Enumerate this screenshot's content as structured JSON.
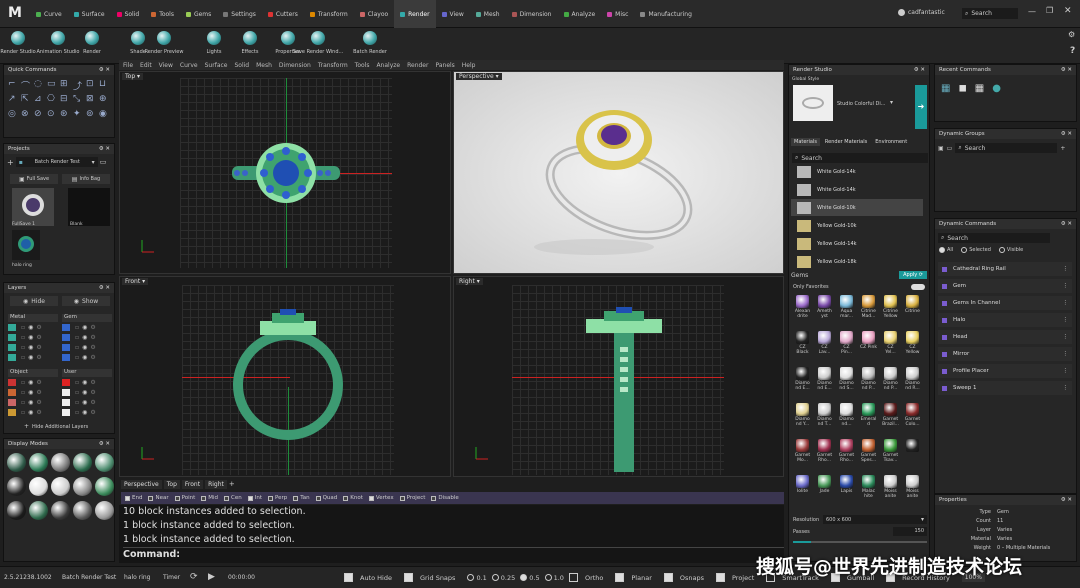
{
  "app": {
    "logo": "M"
  },
  "tabs": [
    {
      "label": "Curve",
      "color": "#4caf50"
    },
    {
      "label": "Surface",
      "color": "#3aa"
    },
    {
      "label": "Solid",
      "color": "#e06"
    },
    {
      "label": "Tools",
      "color": "#c63"
    },
    {
      "label": "Gems",
      "color": "#9c5"
    },
    {
      "label": "Settings",
      "color": "#777"
    },
    {
      "label": "Cutters",
      "color": "#d33"
    },
    {
      "label": "Transform",
      "color": "#d80"
    },
    {
      "label": "Clayoo",
      "color": "#c66"
    },
    {
      "label": "Render",
      "color": "#3aa"
    },
    {
      "label": "View",
      "color": "#66c"
    },
    {
      "label": "Mesh",
      "color": "#5a9"
    },
    {
      "label": "Dimension",
      "color": "#a55"
    },
    {
      "label": "Analyze",
      "color": "#4a4"
    },
    {
      "label": "Misc",
      "color": "#c4a"
    },
    {
      "label": "Manufacturing",
      "color": "#888"
    }
  ],
  "user": "cadfantastic",
  "search_placeholder": "Search",
  "ribbon": [
    "Render Studio",
    "Animation Studio",
    "Render",
    "Shade",
    "Render Preview",
    "Lights",
    "Effects",
    "Properties",
    "Save Render Wind...",
    "Batch Render"
  ],
  "menu": [
    "File",
    "Edit",
    "View",
    "Curve",
    "Surface",
    "Solid",
    "Mesh",
    "Dimension",
    "Transform",
    "Tools",
    "Analyze",
    "Render",
    "Panels",
    "Help"
  ],
  "quick_commands": {
    "title": "Quick Commands"
  },
  "projects": {
    "title": "Projects",
    "selected": "Batch Render Test",
    "full_save": "Full Save",
    "info_bag": "Info Bag",
    "thumbs": [
      "FullSave 1",
      "Blank",
      "halo ring"
    ]
  },
  "layers": {
    "title": "Layers",
    "hide": "Hide",
    "show": "Show",
    "groups": [
      {
        "name": "Metal",
        "colors": [
          "#3a9",
          "#3a9",
          "#3a9",
          "#3a9"
        ]
      },
      {
        "name": "Gem",
        "colors": [
          "#36c",
          "#36c",
          "#36c",
          "#36c"
        ]
      },
      {
        "name": "Object",
        "colors": [
          "#c33",
          "#c63",
          "#c66",
          "#c93"
        ]
      },
      {
        "name": "User",
        "colors": [
          "#d22",
          "#eee",
          "#eee",
          "#eee"
        ]
      }
    ],
    "hide_additional": "Hide Additional Layers"
  },
  "display_modes": {
    "title": "Display Modes"
  },
  "viewports": {
    "top": "Top",
    "perspective": "Perspective",
    "front": "Front",
    "right": "Right"
  },
  "viewport_tabs": [
    "Perspective",
    "Top",
    "Front",
    "Right"
  ],
  "osnaps": [
    "End",
    "Near",
    "Point",
    "Mid",
    "Cen",
    "Int",
    "Perp",
    "Tan",
    "Quad",
    "Knot",
    "Vertex",
    "Project",
    "Disable"
  ],
  "command_history": [
    "10 block instances added to selection.",
    "1 block instance added to selection.",
    "1 block instance added to selection."
  ],
  "command_prompt": "Command:",
  "render_studio": {
    "title": "Render Studio",
    "global_style": "Global Style",
    "style_name": "Studio Colorful Di...",
    "tabs": [
      "Materials",
      "Render Materials",
      "Environment"
    ],
    "search": "Search",
    "materials": [
      "White Gold-14k",
      "White Gold-14k",
      "White Gold-10k",
      "Yellow Gold-10k",
      "Yellow Gold-14k",
      "Yellow Gold-18k"
    ],
    "gems_label": "Gems",
    "apply": "Apply",
    "only_favorites": "Only Favorites",
    "gems": [
      "Alexan drite",
      "Ameth yst",
      "Aqua mar...",
      "Citrine Mad...",
      "Citrine Yellow",
      "Citrine",
      "CZ Black",
      "CZ Lav...",
      "CZ Pin...",
      "CZ Pink",
      "CZ Yel...",
      "CZ Yellow",
      "Diamo nd E...",
      "Diamo nd E...",
      "Diamo nd S...",
      "Diamo nd P...",
      "Diamo nd P...",
      "Diamo nd R...",
      "Diamo nd Y...",
      "Diamo nd T...",
      "Diamo nd...",
      "Emeral d",
      "Garnet Brazil...",
      "Garnet Colo...",
      "Garnet Mo...",
      "Garnet Rho...",
      "Garnet Rho...",
      "Garnet Spes...",
      "Garnet Tsav...",
      "",
      "Iolite",
      "Jade",
      "Lapis",
      "Malac hite",
      "Moiss anite",
      "Moiss anite"
    ],
    "resolution_label": "Resolution",
    "resolution": "600 x 600",
    "passes_label": "Passes",
    "passes": "150"
  },
  "recent_commands": {
    "title": "Recent Commands"
  },
  "dynamic_groups": {
    "title": "Dynamic Groups",
    "search": "Search"
  },
  "dynamic_commands": {
    "title": "Dynamic Commands",
    "search": "Search",
    "filters": [
      "All",
      "Selected",
      "Visible"
    ],
    "items": [
      "Cathedral Ring Rail",
      "Gem",
      "Gems In Channel",
      "Halo",
      "Head",
      "Mirror",
      "Profile Placer",
      "Sweep 1"
    ]
  },
  "properties": {
    "title": "Properties",
    "rows": [
      [
        "Type",
        "Gem"
      ],
      [
        "Count",
        "11"
      ],
      [
        "Layer",
        "Varies"
      ],
      [
        "Material",
        "Varies"
      ],
      [
        "Weight",
        "0 – Multiple Materials"
      ]
    ]
  },
  "status": {
    "version": "2.5.21238.1002",
    "batch": "Batch Render Test",
    "file": "halo ring",
    "timer_label": "Timer",
    "time": "00:00:00",
    "auto_hide": "Auto Hide",
    "grid_snaps": "Grid Snaps",
    "snaps": [
      "0.1",
      "0.25",
      "0.5",
      "1.0"
    ],
    "ortho": "Ortho",
    "planar": "Planar",
    "osnaps": "Osnaps",
    "project": "Project",
    "smarttrack": "SmartTrack",
    "gumball": "Gumball",
    "record_history": "Record History",
    "zoom": "100%"
  },
  "watermark": "搜狐号@世界先进制造技术论坛"
}
